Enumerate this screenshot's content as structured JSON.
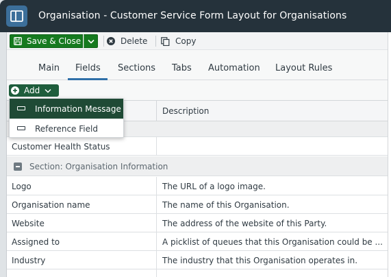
{
  "window": {
    "title": "Organisation - Customer Service Form Layout for Organisations"
  },
  "toolbar": {
    "save_label": "Save & Close",
    "delete_label": "Delete",
    "copy_label": "Copy"
  },
  "tabs": [
    {
      "label": "Main",
      "selected": false
    },
    {
      "label": "Fields",
      "selected": true
    },
    {
      "label": "Sections",
      "selected": false
    },
    {
      "label": "Tabs",
      "selected": false
    },
    {
      "label": "Automation",
      "selected": false
    },
    {
      "label": "Layout Rules",
      "selected": false
    }
  ],
  "add_button": {
    "label": "Add"
  },
  "add_menu": {
    "items": [
      {
        "label": "Information Message",
        "highlighted": true
      },
      {
        "label": "Reference Field",
        "highlighted": false
      }
    ]
  },
  "table": {
    "columns": {
      "description": "Description"
    },
    "top_rows": [
      {
        "name": "Customer Health Status",
        "description": ""
      }
    ],
    "section": {
      "label": "Section: Organisation Information"
    },
    "rows": [
      {
        "name": "Logo",
        "description": "The URL of a logo image."
      },
      {
        "name": "Organisation name",
        "description": "The name of this Organisation."
      },
      {
        "name": "Website",
        "description": "The address of the website of this Party."
      },
      {
        "name": "Assigned to",
        "description": "A picklist of queues that this Organisation could be ..."
      },
      {
        "name": "Industry",
        "description": "The industry that this Organisation operates in."
      }
    ]
  },
  "colors": {
    "titlebar": "#25323b",
    "save_green": "#157a1f",
    "add_green": "#1e5d3c",
    "tab_accent": "#2f6fa8",
    "menu_highlight": "#1f4a35"
  }
}
